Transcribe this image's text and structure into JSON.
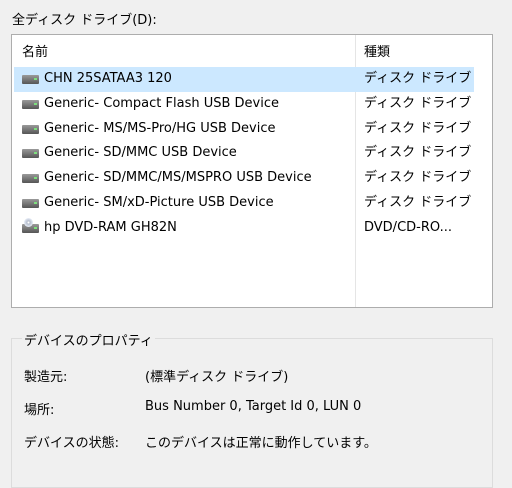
{
  "section_label": "全ディスク ドライブ(D):",
  "list": {
    "columns": {
      "name": "名前",
      "type": "種類"
    },
    "rows": [
      {
        "name": "CHN 25SATAA3 120",
        "type": "ディスク ドライブ",
        "icon": "hard-drive-icon",
        "selected": true
      },
      {
        "name": "Generic- Compact Flash USB Device",
        "type": "ディスク ドライブ",
        "icon": "hard-drive-icon"
      },
      {
        "name": "Generic- MS/MS-Pro/HG USB Device",
        "type": "ディスク ドライブ",
        "icon": "hard-drive-icon"
      },
      {
        "name": "Generic- SD/MMC USB Device",
        "type": "ディスク ドライブ",
        "icon": "hard-drive-icon"
      },
      {
        "name": "Generic- SD/MMC/MS/MSPRO USB Device",
        "type": "ディスク ドライブ",
        "icon": "hard-drive-icon"
      },
      {
        "name": "Generic- SM/xD-Picture USB Device",
        "type": "ディスク ドライブ",
        "icon": "hard-drive-icon"
      },
      {
        "name": "hp DVD-RAM GH82N",
        "type": "DVD/CD-RO...",
        "icon": "dvd-drive-icon"
      }
    ]
  },
  "properties": {
    "title": "デバイスのプロパティ",
    "manufacturer_label": "製造元:",
    "manufacturer_value": "(標準ディスク ドライブ)",
    "location_label": "場所:",
    "location_value": "Bus Number 0, Target Id 0, LUN 0",
    "status_label": "デバイスの状態:",
    "status_value": "このデバイスは正常に動作しています。"
  },
  "colors": {
    "selection": "#cce8ff",
    "window_bg": "#f0f0f0"
  }
}
